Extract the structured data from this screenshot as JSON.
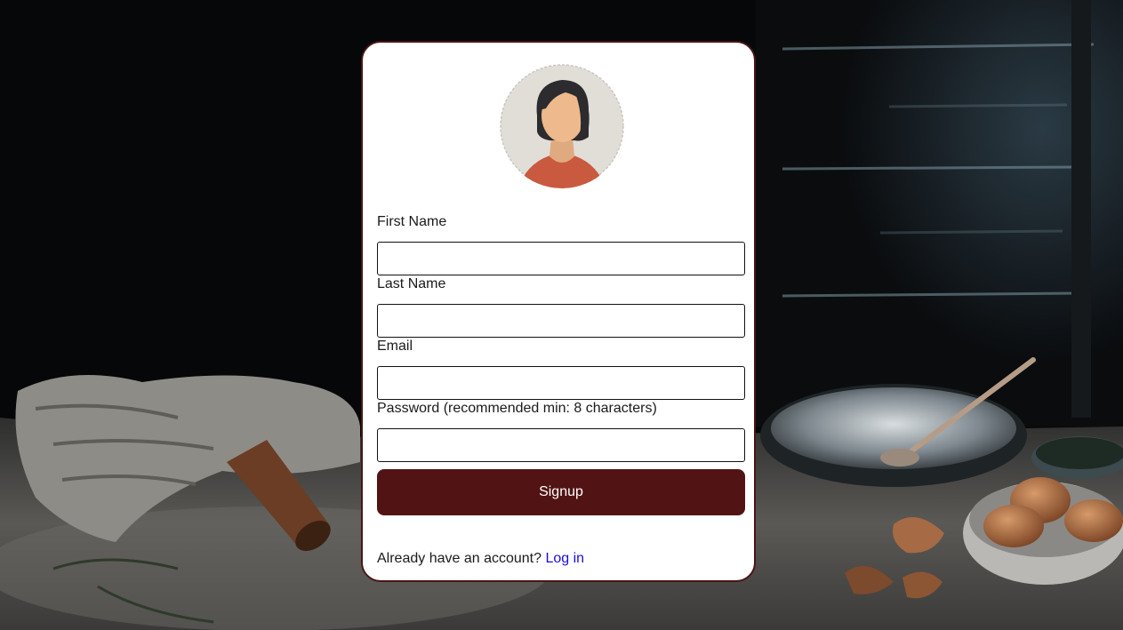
{
  "form": {
    "first_name_label": "First Name",
    "first_name_value": "",
    "last_name_label": "Last Name",
    "last_name_value": "",
    "email_label": "Email",
    "email_value": "",
    "password_label": "Password (recommended min: 8 characters)",
    "password_value": "",
    "submit_label": "Signup"
  },
  "footer": {
    "prompt_text": "Already have an account?",
    "login_link": "Log in"
  },
  "avatar": {
    "icon": "woman-avatar-icon"
  },
  "colors": {
    "accent": "#521314",
    "card_border": "#4a1517",
    "link": "#1a0dd6"
  }
}
